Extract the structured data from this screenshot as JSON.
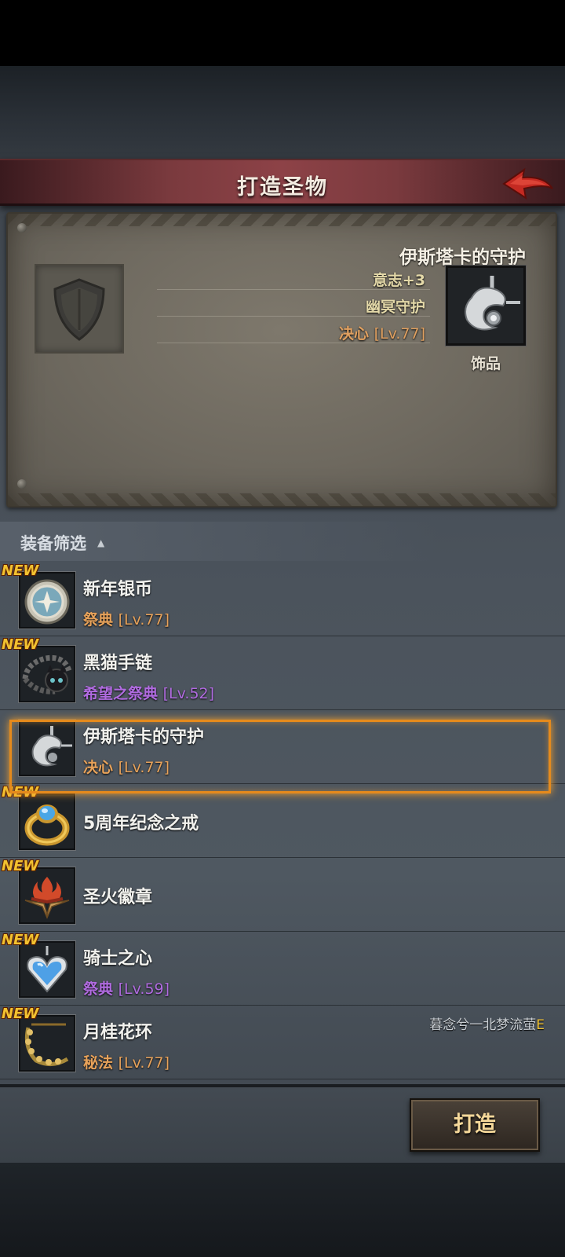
{
  "header": {
    "title": "打造圣物"
  },
  "preview": {
    "item_name": "伊斯塔卡的守护",
    "stats": [
      "意志+3",
      "幽冥守护"
    ],
    "requirement_name": "决心",
    "requirement_level": "[Lv.77]",
    "item_type": "饰品"
  },
  "filter": {
    "label": "装备筛选",
    "caret": "▲"
  },
  "items": [
    {
      "new_tag": "NEW",
      "name": "新年银币",
      "tag": "祭典",
      "level": "[Lv.77]",
      "tag_color": "#e7a25a"
    },
    {
      "new_tag": "NEW",
      "name": "黑猫手链",
      "tag": "希望之祭典",
      "level": "[Lv.52]",
      "tag_color": "#b06be0"
    },
    {
      "new_tag": "",
      "name": "伊斯塔卡的守护",
      "tag": "决心",
      "level": "[Lv.77]",
      "tag_color": "#e7a25a"
    },
    {
      "new_tag": "NEW",
      "name": "5周年纪念之戒",
      "tag": "",
      "level": "",
      "tag_color": ""
    },
    {
      "new_tag": "NEW",
      "name": "圣火徽章",
      "tag": "",
      "level": "",
      "tag_color": ""
    },
    {
      "new_tag": "NEW",
      "name": "骑士之心",
      "tag": "祭典",
      "level": "[Lv.59]",
      "tag_color": "#b06be0"
    },
    {
      "new_tag": "NEW",
      "name": "月桂花环",
      "tag": "秘法",
      "level": "[Lv.77]",
      "tag_color": "#e7a25a"
    }
  ],
  "player_tag": {
    "name": "暮念兮一北梦流萤",
    "suffix": "E"
  },
  "actions": {
    "craft_label": "打造"
  },
  "colors": {
    "accent_orange": "#e58a1c",
    "title_bar": "#8d4247",
    "purple_tag": "#b06be0",
    "orange_tag": "#e7a25a",
    "new_tag": "#f2c230"
  },
  "icons": {
    "back": "red-back-arrow-icon",
    "empty_slot": "shield-icon",
    "items": [
      "silver-coin-icon",
      "black-cat-bracelet-icon",
      "silver-pendant-icon",
      "gold-ring-icon",
      "fire-badge-icon",
      "heart-pendant-icon",
      "laurel-wreath-icon"
    ]
  }
}
